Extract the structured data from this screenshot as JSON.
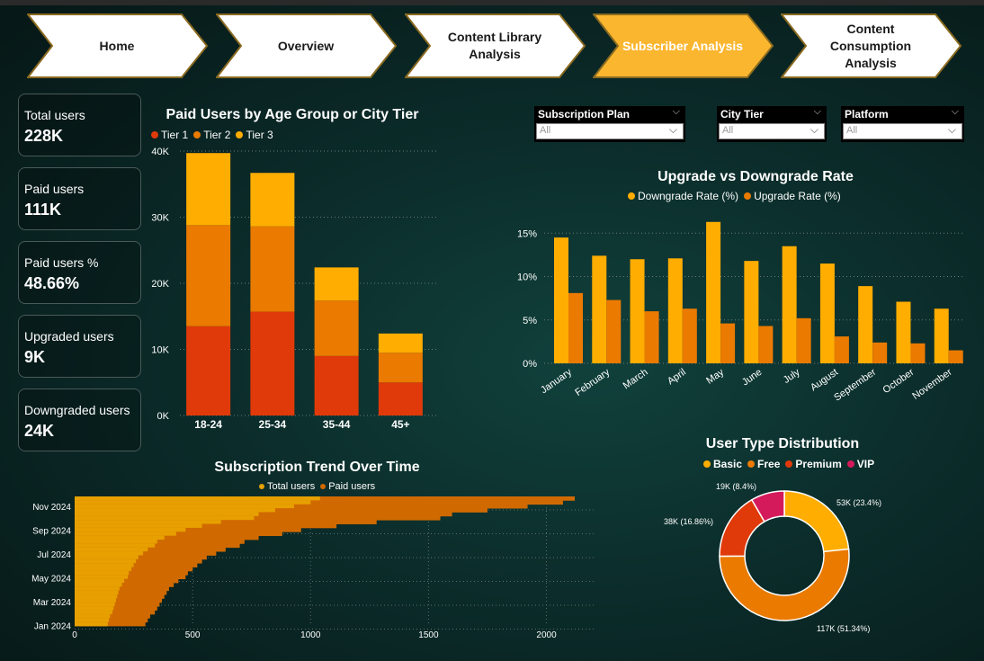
{
  "nav": [
    {
      "label": "Home",
      "active": false
    },
    {
      "label": "Overview",
      "active": false
    },
    {
      "label": "Content Library Analysis",
      "active": false
    },
    {
      "label": "Subscriber Analysis",
      "active": true
    },
    {
      "label": "Content Consumption Analysis",
      "active": false
    }
  ],
  "kpis": [
    {
      "label": "Total users",
      "value": "228K"
    },
    {
      "label": "Paid users",
      "value": "111K"
    },
    {
      "label": "Paid users %",
      "value": "48.66%"
    },
    {
      "label": "Upgraded users",
      "value": "9K"
    },
    {
      "label": "Downgraded users",
      "value": "24K"
    }
  ],
  "slicers": [
    {
      "title": "Subscription Plan",
      "value": "All"
    },
    {
      "title": "City Tier",
      "value": "All"
    },
    {
      "title": "Platform",
      "value": "All"
    }
  ],
  "colors": {
    "tier1": "#e03a0a",
    "tier2": "#ea7a00",
    "tier3": "#ffad00",
    "basic": "#ffad00",
    "free": "#ea7a00",
    "premium": "#e03a0a",
    "vip": "#d41a5a",
    "total": "#e7a000",
    "paid": "#d06a00"
  },
  "chart_data": [
    {
      "id": "paid_age",
      "type": "bar",
      "stacked": true,
      "title": "Paid Users by Age Group or City Tier",
      "categories": [
        "18-24",
        "25-34",
        "35-44",
        "45+"
      ],
      "series": [
        {
          "name": "Tier 1",
          "values": [
            13500,
            15700,
            9000,
            5000
          ]
        },
        {
          "name": "Tier 2",
          "values": [
            15300,
            12900,
            8400,
            4500
          ]
        },
        {
          "name": "Tier 3",
          "values": [
            10900,
            8100,
            5000,
            2900
          ]
        }
      ],
      "yticks": [
        "0K",
        "10K",
        "20K",
        "30K",
        "40K"
      ],
      "ylim": [
        0,
        40000
      ],
      "legend": "top-left",
      "grid": true
    },
    {
      "id": "up_down",
      "type": "bar",
      "title": "Upgrade vs Downgrade Rate",
      "categories": [
        "January",
        "February",
        "March",
        "April",
        "May",
        "June",
        "July",
        "August",
        "September",
        "October",
        "November"
      ],
      "series": [
        {
          "name": "Downgrade Rate (%)",
          "values": [
            14.5,
            12.4,
            12.0,
            12.1,
            16.3,
            11.8,
            13.5,
            11.5,
            8.9,
            7.1,
            6.3
          ]
        },
        {
          "name": "Upgrade Rate (%)",
          "values": [
            8.1,
            7.3,
            6.0,
            6.3,
            4.6,
            4.3,
            5.2,
            3.1,
            2.4,
            2.3,
            1.5
          ]
        }
      ],
      "yticks": [
        "0%",
        "5%",
        "10%",
        "15%"
      ],
      "ylim": [
        0,
        17
      ],
      "legend": "top",
      "grid": true
    },
    {
      "id": "trend",
      "type": "bar",
      "orientation": "horizontal",
      "title": "Subscription Trend Over Time",
      "series": [
        {
          "name": "Total users",
          "values": [
            2120,
            2070,
            1920,
            1750,
            1600,
            1550,
            1280,
            1110,
            960,
            880,
            780,
            720,
            700,
            640,
            600,
            560,
            540,
            520,
            500,
            480,
            470,
            440,
            420,
            400,
            390,
            380,
            370,
            360,
            350,
            340,
            320,
            310,
            300
          ]
        },
        {
          "name": "Paid users",
          "values": [
            1040,
            1000,
            930,
            850,
            780,
            760,
            620,
            540,
            470,
            430,
            380,
            350,
            340,
            310,
            290,
            270,
            260,
            250,
            240,
            230,
            225,
            210,
            200,
            190,
            185,
            180,
            175,
            170,
            165,
            160,
            150,
            145,
            140
          ]
        }
      ],
      "yticks": [
        "Nov 2024",
        "Sep 2024",
        "Jul 2024",
        "May 2024",
        "Mar 2024",
        "Jan 2024"
      ],
      "xticks": [
        "0",
        "500",
        "1000",
        "1500",
        "2000"
      ],
      "xlim": [
        0,
        2200
      ],
      "legend": "top",
      "grid": true
    },
    {
      "id": "user_type",
      "type": "pie",
      "donut": true,
      "title": "User Type Distribution",
      "slices": [
        {
          "name": "Basic",
          "value": 53,
          "label": "53K (23.4%)"
        },
        {
          "name": "Free",
          "value": 117,
          "label": "117K (51.34%)"
        },
        {
          "name": "Premium",
          "value": 38,
          "label": "38K (16.86%)"
        },
        {
          "name": "VIP",
          "value": 19,
          "label": "19K (8.4%)"
        }
      ],
      "legend": "top"
    }
  ]
}
